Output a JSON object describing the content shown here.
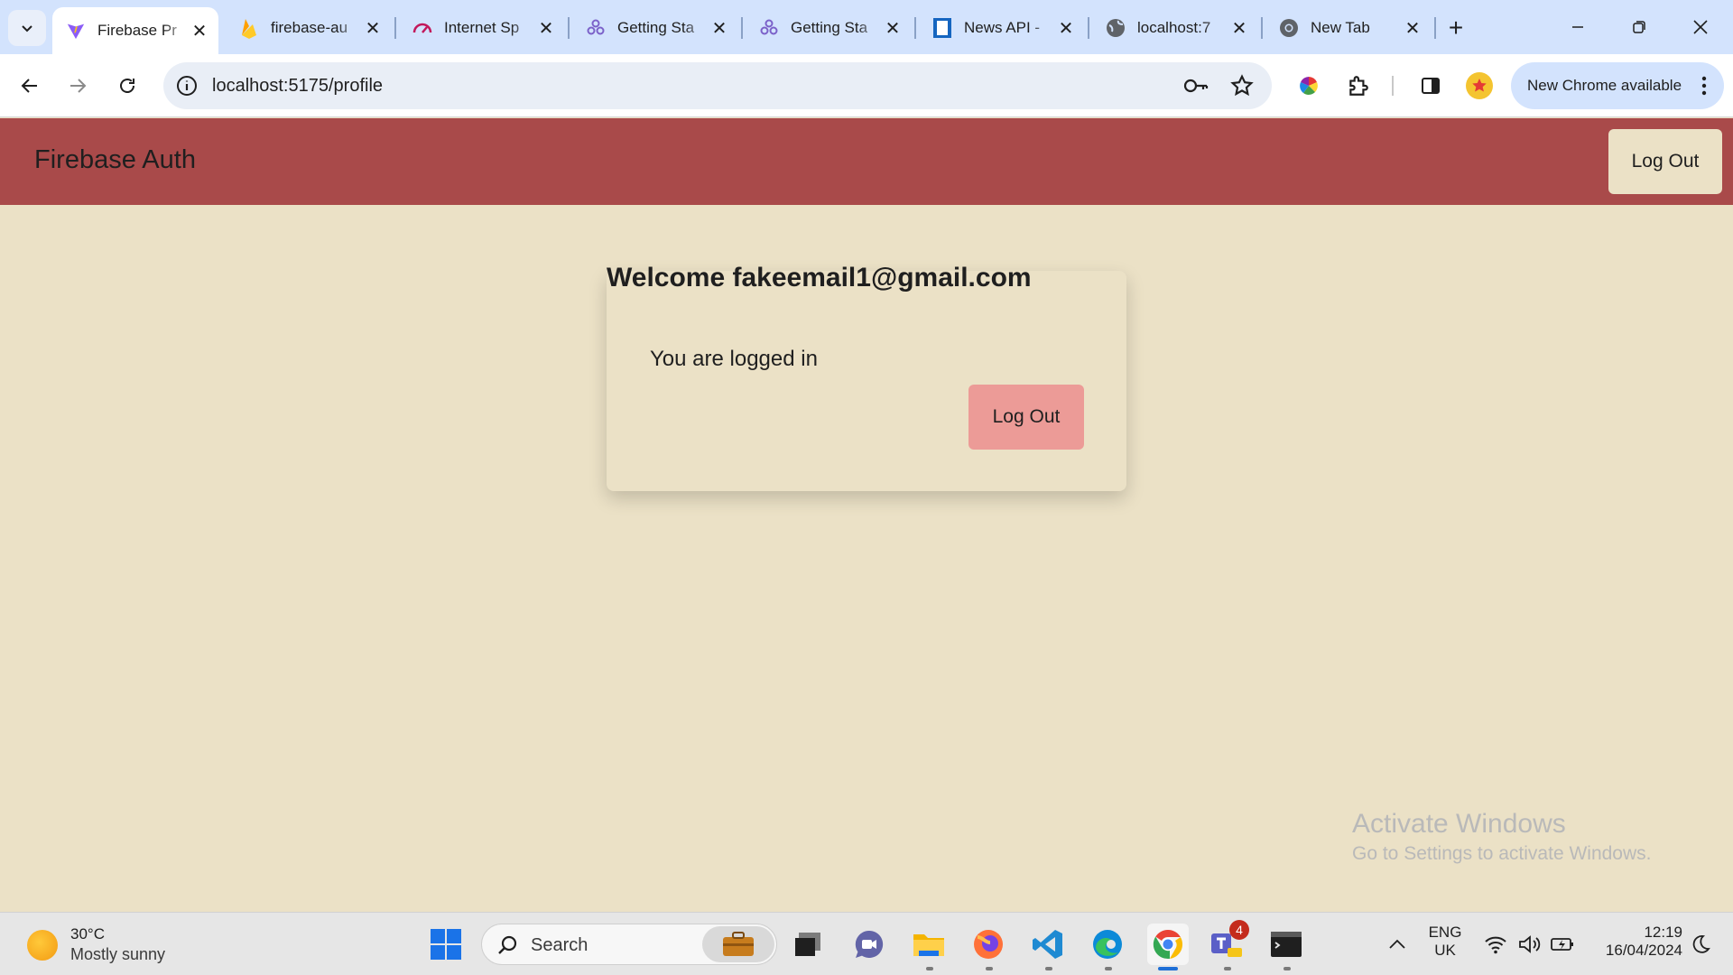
{
  "browser": {
    "tabs": [
      {
        "title": "Firebase Pr",
        "active": true,
        "favicon": "vite-icon"
      },
      {
        "title": "firebase-au",
        "active": false,
        "favicon": "firebase-icon"
      },
      {
        "title": "Internet Sp",
        "active": false,
        "favicon": "speedtest-icon"
      },
      {
        "title": "Getting Sta",
        "active": false,
        "favicon": "react-router-icon"
      },
      {
        "title": "Getting Sta",
        "active": false,
        "favicon": "react-router-icon"
      },
      {
        "title": "News API -",
        "active": false,
        "favicon": "news-api-icon"
      },
      {
        "title": "localhost:7",
        "active": false,
        "favicon": "globe-icon"
      },
      {
        "title": "New Tab",
        "active": false,
        "favicon": "chrome-icon"
      }
    ],
    "url": "localhost:5175/profile",
    "update_label": "New Chrome available"
  },
  "app": {
    "brand": "Firebase Auth",
    "nav_logout_label": "Log Out",
    "welcome": "Welcome fakeemail1@gmail.com",
    "status": "You are logged in",
    "card_logout_label": "Log Out"
  },
  "watermark": {
    "line1": "Activate Windows",
    "line2": "Go to Settings to activate Windows."
  },
  "taskbar": {
    "weather_temp": "30°C",
    "weather_cond": "Mostly sunny",
    "search_label": "Search",
    "lang": "ENG",
    "region": "UK",
    "time": "12:19",
    "date": "16/04/2024",
    "teams_badge": "4"
  },
  "colors": {
    "navbar": "#a94a4a",
    "page_bg": "#ebe1c6",
    "card_button": "#ec9b97",
    "tabstrip": "#d3e3fd"
  }
}
